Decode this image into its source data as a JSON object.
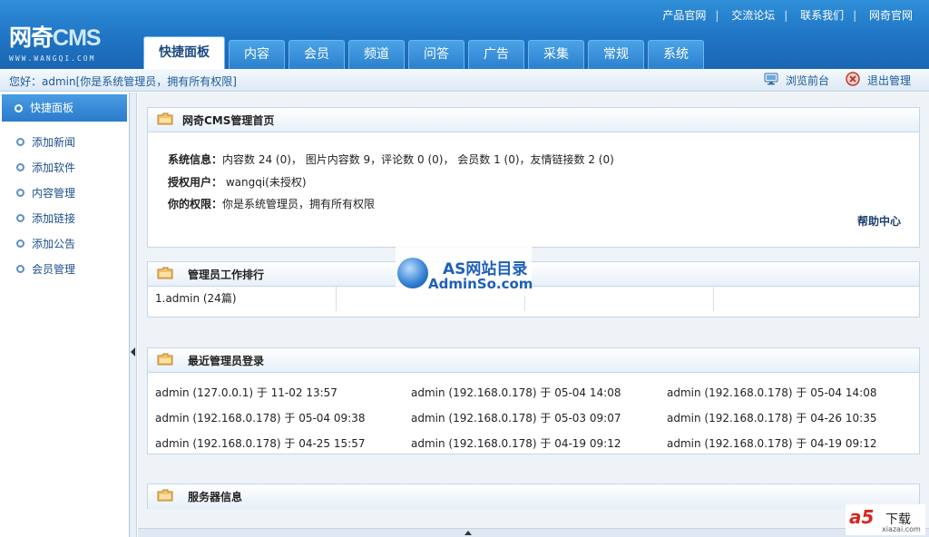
{
  "header": {
    "logo_main": "网奇",
    "logo_cms": "CMS",
    "logo_sub": "WWW.WANGQI.COM",
    "top_links": [
      "产品官网",
      "交流论坛",
      "联系我们",
      "网奇官网"
    ],
    "tabs": [
      {
        "label": "快捷面板",
        "active": true
      },
      {
        "label": "内容",
        "active": false
      },
      {
        "label": "会员",
        "active": false
      },
      {
        "label": "频道",
        "active": false
      },
      {
        "label": "问答",
        "active": false
      },
      {
        "label": "广告",
        "active": false
      },
      {
        "label": "采集",
        "active": false
      },
      {
        "label": "常规",
        "active": false
      },
      {
        "label": "系统",
        "active": false
      }
    ]
  },
  "infobar": {
    "welcome": "您好：admin[你是系统管理员，拥有所有权限]",
    "preview_label": "浏览前台",
    "logout_label": "退出管理"
  },
  "sidebar": {
    "title": "快捷面板",
    "items": [
      "添加新闻",
      "添加软件",
      "内容管理",
      "添加链接",
      "添加公告",
      "会员管理"
    ]
  },
  "panels": {
    "home": {
      "title": "网奇CMS管理首页",
      "sysinfo_label": "系统信息：",
      "sysinfo_text": "内容数 24 (0)， 图片内容数 9，评论数 0 (0)， 会员数 1 (0)，友情链接数 2 (0)",
      "auth_label": "授权用户：",
      "auth_value": "wangqi(未授权)",
      "perm_label": "你的权限：",
      "perm_value": "你是系统管理员，拥有所有权限",
      "help": "帮助中心"
    },
    "ranking": {
      "title": "管理员工作排行",
      "cells": [
        "1.admin (24篇)",
        "",
        "",
        ""
      ]
    },
    "logins": {
      "title": "最近管理员登录",
      "entries": [
        "admin (127.0.0.1) 于 11-02 13:57",
        "admin (192.168.0.178) 于 05-04 14:08",
        "admin (192.168.0.178) 于 05-04 14:08",
        "admin (192.168.0.178) 于 05-04 09:38",
        "admin (192.168.0.178) 于 05-03 09:07",
        "admin (192.168.0.178) 于 04-26 10:35",
        "admin (192.168.0.178) 于 04-25 15:57",
        "admin (192.168.0.178) 于 04-19 09:12",
        "admin (192.168.0.178) 于 04-19 09:12"
      ]
    },
    "server": {
      "title": "服务器信息"
    }
  },
  "watermarks": {
    "as_title": "AS网站目录",
    "as_url": "AdminSo.com",
    "a5_logo": "a5",
    "a5_text": "下载",
    "a5_url": "xiazai.com"
  }
}
